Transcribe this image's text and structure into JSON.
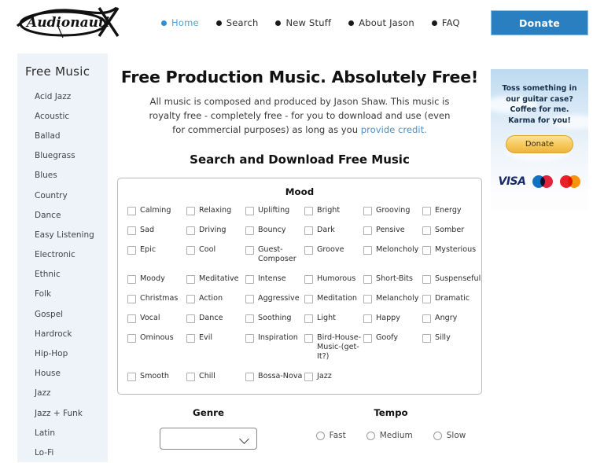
{
  "header": {
    "logo_text": "Audionautix",
    "logo_icon": "audionautix-logo",
    "nav": [
      {
        "label": "Home",
        "active": true
      },
      {
        "label": "Search",
        "active": false
      },
      {
        "label": "New Stuff",
        "active": false
      },
      {
        "label": "About Jason",
        "active": false
      },
      {
        "label": "FAQ",
        "active": false
      }
    ],
    "donate_label": "Donate",
    "donate_color": "#2a7fc1"
  },
  "sidebar": {
    "title": "Free Music",
    "items": [
      "Acid Jazz",
      "Acoustic",
      "Ballad",
      "Bluegrass",
      "Blues",
      "Country",
      "Dance",
      "Easy Listening",
      "Electronic",
      "Ethnic",
      "Folk",
      "Gospel",
      "Hardrock",
      "Hip-Hop",
      "House",
      "Jazz",
      "Jazz + Funk",
      "Latin",
      "Lo-Fi"
    ]
  },
  "main": {
    "heading": "Free Production Music. Absolutely Free!",
    "intro_part1": "All music is composed and produced by Jason Shaw. This music is royalty free - completely free - for you to download and use (even for commercial purposes) as long as you ",
    "intro_link": "provide credit.",
    "subheading": "Search and Download Free Music",
    "mood": {
      "title": "Mood",
      "rows": [
        [
          "Calming",
          "Relaxing",
          "Uplifting",
          "Bright",
          "Grooving",
          "Energy"
        ],
        [
          "Sad",
          "Driving",
          "Bouncy",
          "Dark",
          "Pensive",
          "Somber"
        ],
        [
          "Epic",
          "Cool",
          "Guest-Composer",
          "Groove",
          "Meloncholy",
          "Mysterious"
        ],
        [
          "Moody",
          "Meditative",
          "Intense",
          "Humorous",
          "Short-Bits",
          "Suspenseful"
        ],
        [
          "Christmas",
          "Action",
          "Aggressive",
          "Meditation",
          "Melancholy",
          "Dramatic"
        ],
        [
          "Vocal",
          "Dance",
          "Soothing",
          "Light",
          "Happy",
          "Angry"
        ],
        [
          "Ominous",
          "Evil",
          "Inspiration",
          "Bird-House-Music-(get-It?)",
          "Goofy",
          "Silly"
        ],
        [
          "Smooth",
          "Chill",
          "Bossa-Nova",
          "Jazz"
        ]
      ]
    },
    "genre": {
      "title": "Genre",
      "value": "",
      "icon": "chevron-down-icon"
    },
    "tempo": {
      "title": "Tempo",
      "options": [
        "Fast",
        "Medium",
        "Slow"
      ]
    }
  },
  "aside": {
    "pitch": "Toss something in our guitar case? Coffee for me. Karma for you!",
    "donate_label": "Donate",
    "cards": [
      "VISA",
      "maestro-card",
      "mastercard-card"
    ]
  }
}
